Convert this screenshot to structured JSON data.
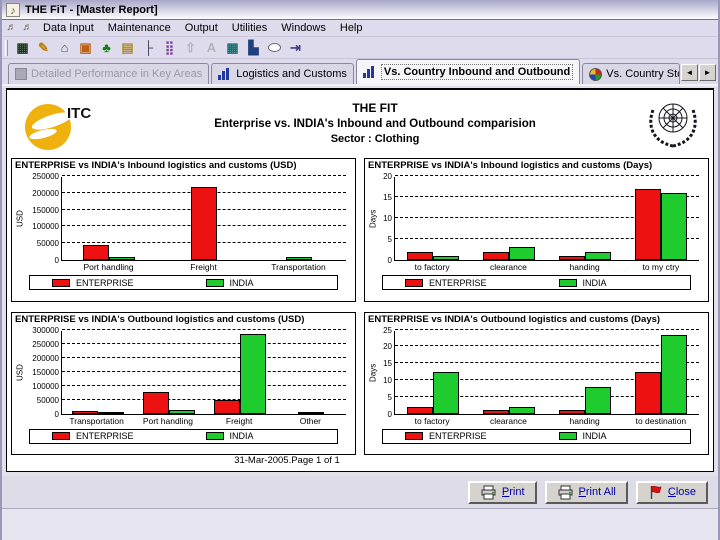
{
  "window": {
    "title": "THE FiT - [Master Report]"
  },
  "menu": {
    "items": [
      "Data Input",
      "Maintenance",
      "Output",
      "Utilities",
      "Windows",
      "Help"
    ]
  },
  "toolbar": {
    "icons": [
      {
        "name": "report-grid-icon",
        "glyph": "▦",
        "color": "#143a14",
        "disabled": false
      },
      {
        "name": "data-entry-icon",
        "glyph": "✎",
        "color": "#c08000",
        "disabled": false
      },
      {
        "name": "bank-icon",
        "glyph": "⌂",
        "color": "#7a4a10",
        "disabled": false
      },
      {
        "name": "picture-icon",
        "glyph": "▣",
        "color": "#c06010",
        "disabled": false
      },
      {
        "name": "tree-icon",
        "glyph": "♣",
        "color": "#108010",
        "disabled": false
      },
      {
        "name": "notebook-icon",
        "glyph": "▤",
        "color": "#b08820",
        "disabled": false
      },
      {
        "name": "hierarchy-icon",
        "glyph": "├",
        "color": "#404060",
        "disabled": false
      },
      {
        "name": "dots-grid-icon",
        "glyph": "⣿",
        "color": "#8040a0",
        "disabled": false
      },
      {
        "name": "thumb-icon",
        "glyph": "⇧",
        "color": "#909090",
        "disabled": true
      },
      {
        "name": "font-icon",
        "glyph": "A",
        "color": "#909090",
        "disabled": true
      },
      {
        "name": "calculator-icon",
        "glyph": "▦",
        "color": "#107070",
        "disabled": false
      },
      {
        "name": "chart-edit-icon",
        "glyph": "▙",
        "color": "#204080",
        "disabled": false
      },
      {
        "name": "speech-bubble-icon",
        "glyph": "",
        "color": "#606060",
        "disabled": false,
        "shape": "bubble"
      },
      {
        "name": "exit-icon",
        "glyph": "⇥",
        "color": "#404080",
        "disabled": false
      }
    ]
  },
  "tabs": {
    "items": [
      {
        "label": "Detailed Performance in Key Areas",
        "icon": "square",
        "state": "disabled"
      },
      {
        "label": "Logistics and Customs",
        "icon": "barchart",
        "state": "normal"
      },
      {
        "label": "Vs. Country Inbound and Outbound",
        "icon": "barchart",
        "state": "active"
      },
      {
        "label": "Vs. Country Stocks a",
        "icon": "pie",
        "state": "truncated"
      }
    ],
    "scroll_left": "◄",
    "scroll_right": "►"
  },
  "report": {
    "header": {
      "logo_left_text": "ITC",
      "title": "THE FIT",
      "subtitle": "Enterprise vs. INDIA's Inbound and Outbound comparision",
      "sector": "Sector : Clothing"
    },
    "footer": "31-Mar-2005.Page 1 of 1"
  },
  "colors": {
    "enterprise": "#ee1111",
    "india": "#1ecc2e"
  },
  "buttons": {
    "print": {
      "pre": "P",
      "rest": "rint"
    },
    "print_all": {
      "pre": "P",
      "rest": "rint All"
    },
    "close": {
      "pre": "C",
      "rest": "lose"
    }
  },
  "chart_data": [
    {
      "type": "bar",
      "title": "ENTERPRISE vs INDIA's Inbound logistics and customs (USD)",
      "ylabel": "USD",
      "ylim": [
        0,
        250000
      ],
      "yticks": [
        0,
        50000,
        100000,
        150000,
        200000,
        250000
      ],
      "grid": "dashed",
      "legend_position": "bottom",
      "categories": [
        "Port handling",
        "Freight",
        "Transportation"
      ],
      "series": [
        {
          "name": "ENTERPRISE",
          "values": [
            45000,
            218000,
            0
          ]
        },
        {
          "name": "INDIA",
          "values": [
            8000,
            0,
            8000
          ]
        }
      ]
    },
    {
      "type": "bar",
      "title": "ENTERPRISE vs INDIA's Inbound logistics and customs (Days)",
      "ylabel": "Days",
      "ylim": [
        0,
        20
      ],
      "yticks": [
        0,
        5,
        10,
        15,
        20
      ],
      "grid": "dashed",
      "legend_position": "bottom",
      "categories": [
        "to factory",
        "clearance",
        "handing",
        "to my ctry"
      ],
      "series": [
        {
          "name": "ENTERPRISE",
          "values": [
            2,
            2,
            1,
            17
          ]
        },
        {
          "name": "INDIA",
          "values": [
            1,
            3,
            2,
            16
          ]
        }
      ]
    },
    {
      "type": "bar",
      "title": "ENTERPRISE vs INDIA's Outbound logistics and customs (USD)",
      "ylabel": "USD",
      "ylim": [
        0,
        300000
      ],
      "yticks": [
        0,
        50000,
        100000,
        150000,
        200000,
        250000,
        300000
      ],
      "grid": "dashed",
      "legend_position": "bottom",
      "categories": [
        "Transportation",
        "Port handling",
        "Freight",
        "Other"
      ],
      "series": [
        {
          "name": "ENTERPRISE",
          "values": [
            8000,
            78000,
            50000,
            0
          ]
        },
        {
          "name": "INDIA",
          "values": [
            7000,
            12000,
            285000,
            4000
          ]
        }
      ]
    },
    {
      "type": "bar",
      "title": "ENTERPRISE vs INDIA's Outbound logistics and customs (Days)",
      "ylabel": "Days",
      "ylim": [
        0,
        25
      ],
      "yticks": [
        0,
        5,
        10,
        15,
        20,
        25
      ],
      "grid": "dashed",
      "legend_position": "bottom",
      "categories": [
        "to factory",
        "clearance",
        "handing",
        "to destination"
      ],
      "series": [
        {
          "name": "ENTERPRISE",
          "values": [
            2,
            1,
            1,
            12.5
          ]
        },
        {
          "name": "INDIA",
          "values": [
            12.5,
            2,
            8,
            23.5
          ]
        }
      ]
    }
  ]
}
